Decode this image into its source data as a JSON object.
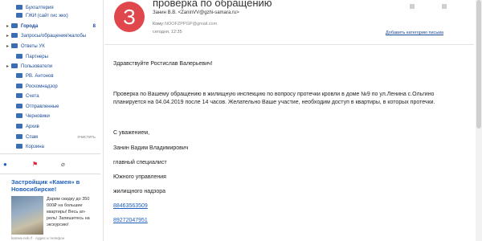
{
  "sidebar": {
    "folders": [
      {
        "label": "Бухгалтерия",
        "indent": 1,
        "bold": false
      },
      {
        "label": "ГЖИ (сайт гис жкх)",
        "indent": 1,
        "bold": false
      },
      {
        "label": "Города",
        "indent": 0,
        "bold": true,
        "count": "8"
      },
      {
        "label": "Запросы/обращения/жалобы",
        "indent": 0,
        "bold": false
      },
      {
        "label": "Ответы УК",
        "indent": 0,
        "bold": false
      },
      {
        "label": "Партнеры",
        "indent": 1,
        "bold": false
      },
      {
        "label": "Пользователи",
        "indent": 0,
        "bold": false
      },
      {
        "label": "РВ. Антонов",
        "indent": 1,
        "bold": false
      },
      {
        "label": "Роскомнадзор",
        "indent": 1,
        "bold": false
      },
      {
        "label": "Счета",
        "indent": 1,
        "bold": false
      },
      {
        "label": "Отправленные",
        "indent": 1,
        "bold": false
      },
      {
        "label": "Черновики",
        "indent": 1,
        "bold": false
      },
      {
        "label": "Архив",
        "indent": 1,
        "bold": false
      },
      {
        "label": "Спам",
        "indent": 1,
        "bold": false,
        "action": "очистить"
      },
      {
        "label": "Корзина",
        "indent": 1,
        "bold": false
      }
    ]
  },
  "ad": {
    "title": "Застройщик «Камея» в Новосибирске!",
    "text": "Дарим скидку до 350 000₽ на большие квартиры! Весь ап-рель! Запишитесь на экскурсию!",
    "footer": "kamea-nsk.rf · Адрес и телефон"
  },
  "email": {
    "avatar_letter": "З",
    "subject": "проверка по обращению",
    "sender": "Занин В.В. <ZaninVV@gzhi-samara.ru>",
    "to_label": "Кому:",
    "to_addr": "NOOFZPPGP@gmail.com",
    "date": "сегодня, 12:35",
    "add_category": "Добавить категорию письма",
    "greeting": "Здравствуйте Ростислав Валерьевич!",
    "para1_line1": "Проверка по Вашему обращению в жилищную инспекцию по вопросу протечки кровли в доме №9 по ул.Ленина с.Ольгино",
    "para1_line2": "планируется на 04.04.2019 после 14 часов. Желательно Ваше участие, необходим доступ в квартиры, в которых протечки.",
    "regards": "С уважением,",
    "sig_name": "Занин Вадим Владимирович",
    "sig_title": "главный специалист",
    "sig_dept1": "Южного управления",
    "sig_dept2": "жилищного надзора",
    "phone1": "88463563509",
    "phone2": "89272047951"
  }
}
